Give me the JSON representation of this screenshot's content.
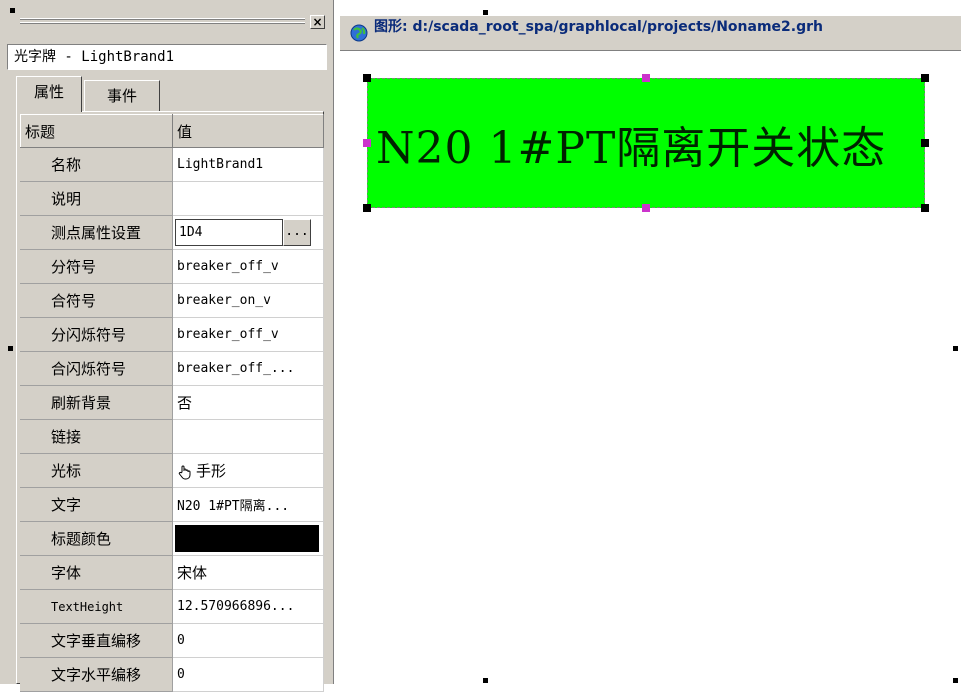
{
  "panel": {
    "close_glyph": "×",
    "object_select": "光字牌 - LightBrand1",
    "tabs": [
      "属性",
      "事件"
    ],
    "grid": {
      "header_name": "标题",
      "header_value": "值",
      "rows": [
        {
          "name": "名称",
          "value": "LightBrand1"
        },
        {
          "name": "说明",
          "value": ""
        },
        {
          "name": "测点属性设置",
          "value": "1D4",
          "button": "..."
        },
        {
          "name": "分符号",
          "value": "breaker_off_v"
        },
        {
          "name": "合符号",
          "value": "breaker_on_v"
        },
        {
          "name": "分闪烁符号",
          "value": "breaker_off_v"
        },
        {
          "name": "合闪烁符号",
          "value": "breaker_off_..."
        },
        {
          "name": "刷新背景",
          "value": "否"
        },
        {
          "name": "链接",
          "value": ""
        },
        {
          "name": "光标",
          "value": "手形",
          "icon": "hand-cursor-icon"
        },
        {
          "name": "文字",
          "value": "N20 1#PT隔离..."
        },
        {
          "name": "标题颜色",
          "value": "",
          "color": "#000000"
        },
        {
          "name": "字体",
          "value": "宋体"
        },
        {
          "name": "TextHeight",
          "value": "12.570966896..."
        },
        {
          "name": "文字垂直编移",
          "value": "0"
        },
        {
          "name": "文字水平编移",
          "value": "0"
        }
      ]
    }
  },
  "graph": {
    "title": "图形: d:/scada_root_spa/graphlocal/projects/Noname2.grh",
    "title_icon": "globe-icon",
    "light_brand": {
      "text": "N20  1#PT隔离开关状态",
      "fill_color": "#00ff00"
    }
  }
}
